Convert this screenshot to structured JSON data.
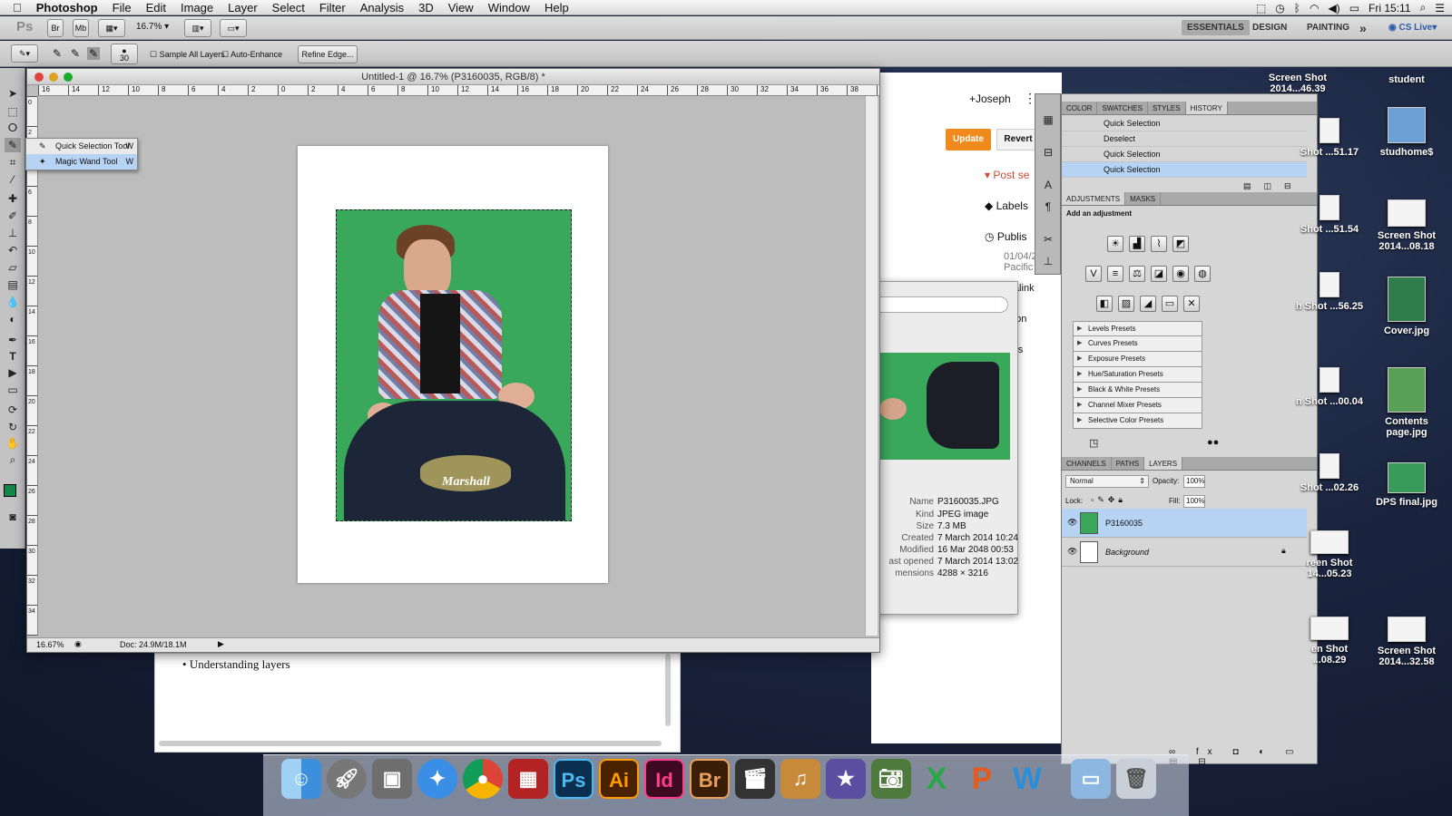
{
  "menubar": {
    "apple": "",
    "app": "Photoshop",
    "items": [
      "File",
      "Edit",
      "Image",
      "Layer",
      "Select",
      "Filter",
      "Analysis",
      "3D",
      "View",
      "Window",
      "Help"
    ],
    "clock": "Fri 15:11"
  },
  "appbar": {
    "ps": "Ps",
    "br": "Br",
    "mb": "Mb",
    "zoom": "16.7%",
    "workspaces": [
      "ESSENTIALS",
      "DESIGN",
      "PAINTING"
    ],
    "more": "»",
    "cslive": "CS Live"
  },
  "options": {
    "brush_size": "30",
    "sample_all_layers": "Sample All Layers",
    "auto_enhance": "Auto-Enhance",
    "refine_edge": "Refine Edge..."
  },
  "document": {
    "title": "Untitled-1 @ 16.7% (P3160035, RGB/8) *",
    "zoom_status": "16.67%",
    "doc_status": "Doc: 24.9M/18.1M",
    "ruler_labels": [
      "16",
      "14",
      "12",
      "10",
      "8",
      "6",
      "4",
      "2",
      "0",
      "2",
      "4",
      "6",
      "8",
      "10",
      "12",
      "14",
      "16",
      "18",
      "20",
      "22",
      "24",
      "26",
      "28",
      "30",
      "32",
      "34",
      "36",
      "38"
    ],
    "vruler_labels": [
      "0",
      "2",
      "4",
      "6",
      "8",
      "10",
      "12",
      "14",
      "16",
      "18",
      "20",
      "22",
      "24",
      "26",
      "28",
      "30",
      "32",
      "34"
    ],
    "photo_brand": "Marshall"
  },
  "flyout": {
    "items": [
      {
        "label": "Quick Selection Tool",
        "key": "W"
      },
      {
        "label": "Magic Wand Tool",
        "key": "W"
      }
    ]
  },
  "blogger": {
    "user": "+Joseph",
    "update": "Update",
    "revert": "Revert",
    "post_settings": "Post se",
    "labels": "Labels",
    "publish": "Publis",
    "date": "01/04/2",
    "timezone": "Pacific",
    "permalink": "ermalink",
    "location": "cation",
    "options": "tions",
    "bullet": "Understanding layers"
  },
  "fileinfo": {
    "rows": [
      {
        "k": "Name",
        "v": "P3160035.JPG"
      },
      {
        "k": "Kind",
        "v": "JPEG image"
      },
      {
        "k": "Size",
        "v": "7.3 MB"
      },
      {
        "k": "Created",
        "v": "7 March 2014 10:24"
      },
      {
        "k": "Modified",
        "v": "16 Mar 2048 00:53"
      },
      {
        "k": "ast opened",
        "v": "7 March 2014 13:02"
      },
      {
        "k": "mensions",
        "v": "4288 × 3216"
      }
    ]
  },
  "panels": {
    "top_tabs": [
      "COLOR",
      "SWATCHES",
      "STYLES",
      "HISTORY"
    ],
    "history": [
      "Quick Selection",
      "Deselect",
      "Quick Selection",
      "Quick Selection"
    ],
    "adj_tabs": [
      "ADJUSTMENTS",
      "MASKS"
    ],
    "adj_title": "Add an adjustment",
    "presets": [
      "Levels Presets",
      "Curves Presets",
      "Exposure Presets",
      "Hue/Saturation Presets",
      "Black & White Presets",
      "Channel Mixer Presets",
      "Selective Color Presets"
    ],
    "layer_tabs": [
      "CHANNELS",
      "PATHS",
      "LAYERS"
    ],
    "blend_mode": "Normal",
    "opacity_label": "Opacity:",
    "opacity": "100%",
    "lock_label": "Lock:",
    "fill_label": "Fill:",
    "fill": "100%",
    "layers": [
      "P3160035",
      "Background"
    ]
  },
  "desktop": {
    "icons": [
      {
        "label": "Screen Shot 2014...46.39"
      },
      {
        "label": "student"
      },
      {
        "label": "Shot ...51.17"
      },
      {
        "label": "studhome$"
      },
      {
        "label": "Shot ...51.54"
      },
      {
        "label": "Screen Shot 2014...08.18"
      },
      {
        "label": "h Shot ...56.25"
      },
      {
        "label": "Cover.jpg"
      },
      {
        "label": "n Shot ...00.04"
      },
      {
        "label": "Contents page.jpg"
      },
      {
        "label": "Shot ...02.26"
      },
      {
        "label": "DPS final.jpg"
      },
      {
        "label": "reen Shot 14...05.23"
      },
      {
        "label": "en Shot ...08.29"
      },
      {
        "label": "Screen Shot 2014...32.58"
      }
    ]
  },
  "dock": {
    "apps": [
      "Finder",
      "Launchpad",
      "Preview",
      "Safari",
      "Chrome",
      "Photo Booth",
      "Ps",
      "Ai",
      "Id",
      "Br",
      "Final Cut",
      "GarageBand",
      "iMovie",
      "iPhoto",
      "Excel",
      "PowerPoint",
      "Word",
      "Documents",
      "Trash"
    ]
  },
  "colors": {
    "ps_blue": "#1b8fd6",
    "accent_orange": "#f08a1c",
    "selection_blue": "#b7d3f4",
    "green_screen": "#39a85a"
  }
}
